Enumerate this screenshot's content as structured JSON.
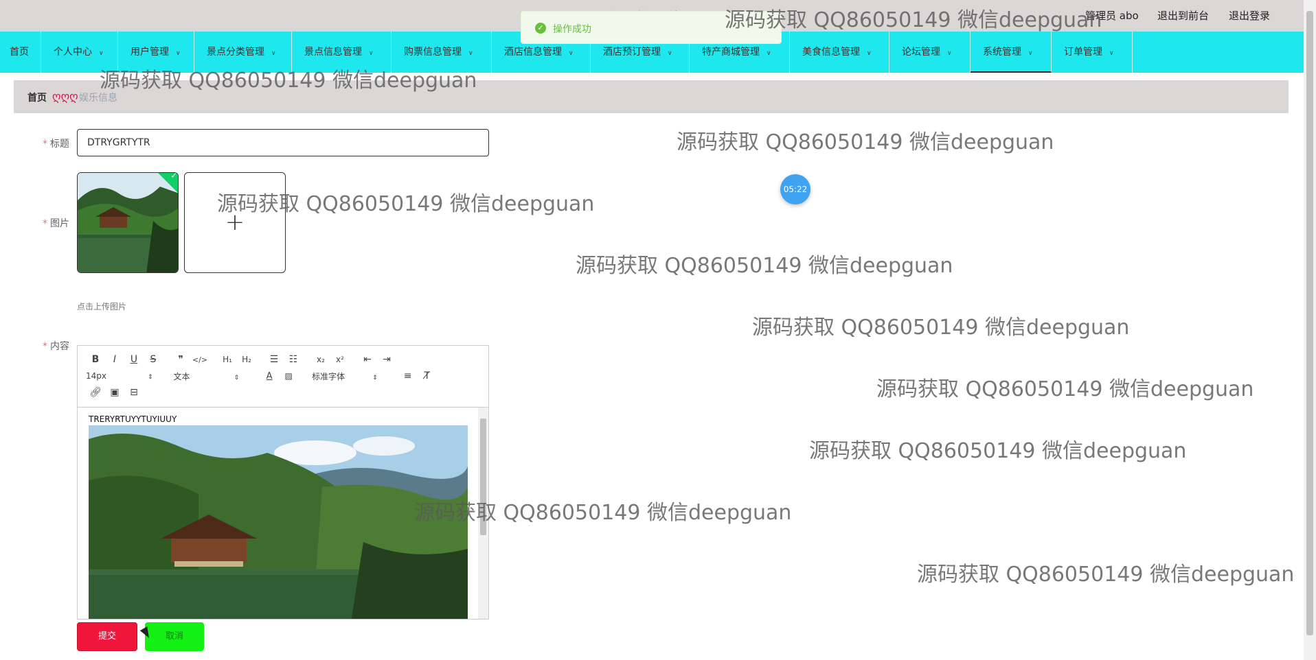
{
  "header": {
    "system_title": "源码资源网站",
    "user_label": "管理员 abo",
    "front_link": "退出到前台",
    "logout_link": "退出登录"
  },
  "toast": {
    "message": "操作成功"
  },
  "nav": [
    {
      "label": "首页",
      "has_chevron": false
    },
    {
      "label": "个人中心",
      "has_chevron": true
    },
    {
      "label": "用户管理",
      "has_chevron": true
    },
    {
      "label": "景点分类管理",
      "has_chevron": true
    },
    {
      "label": "景点信息管理",
      "has_chevron": true
    },
    {
      "label": "购票信息管理",
      "has_chevron": true
    },
    {
      "label": "酒店信息管理",
      "has_chevron": true
    },
    {
      "label": "酒店预订管理",
      "has_chevron": true
    },
    {
      "label": "特产商城管理",
      "has_chevron": true
    },
    {
      "label": "美食信息管理",
      "has_chevron": true
    },
    {
      "label": "论坛管理",
      "has_chevron": true
    },
    {
      "label": "系统管理",
      "has_chevron": true,
      "active": true
    },
    {
      "label": "订单管理",
      "has_chevron": true
    }
  ],
  "breadcrumb": {
    "home": "首页",
    "separator": "ღღღ",
    "current": "娱乐信息"
  },
  "form": {
    "title_label": "标题",
    "title_value": "DTRYGRTYTR",
    "image_label": "图片",
    "upload_hint": "点击上传图片",
    "content_label": "内容",
    "required_mark": "*",
    "submit_label": "提交",
    "cancel_label": "取消"
  },
  "editor": {
    "font_size": "14px",
    "block_format": "文本",
    "font_family": "标准字体",
    "content_text": "TRERYRTUYYTUYIUUY"
  },
  "timer": "05:22",
  "watermark_text": "源码获取 QQ86050149 微信deepguan"
}
